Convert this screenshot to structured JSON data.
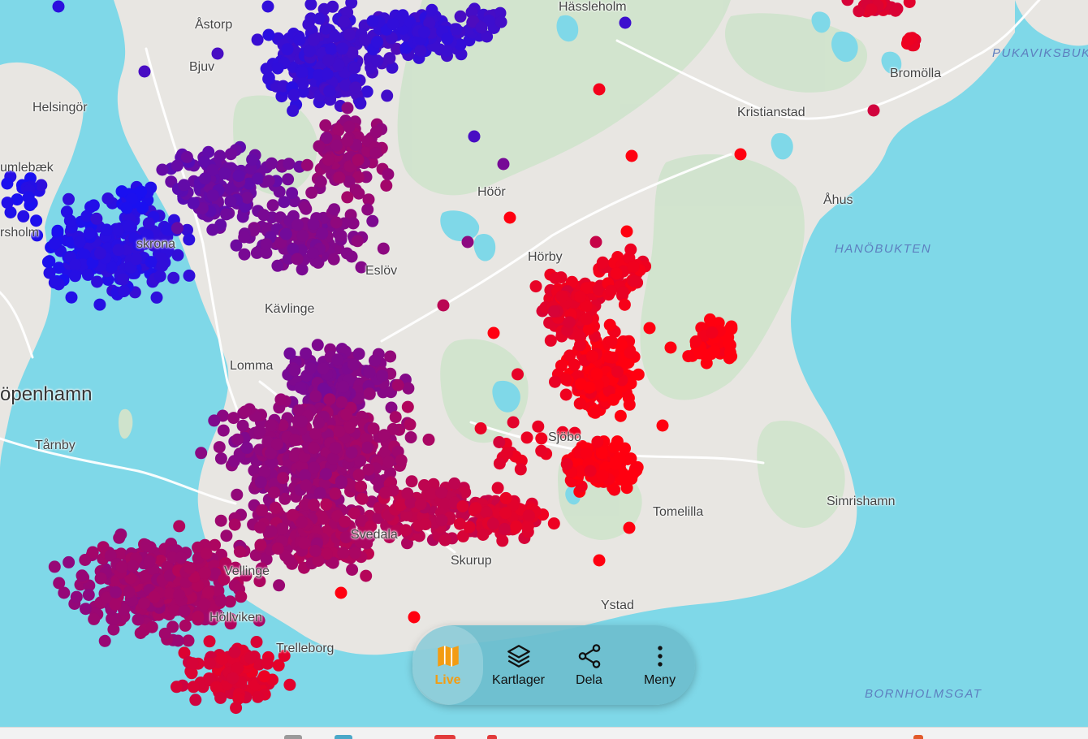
{
  "map": {
    "place_labels": [
      {
        "id": "hassleholm",
        "text": "Hässleholm"
      },
      {
        "id": "astorp",
        "text": "Åstorp"
      },
      {
        "id": "bjuv",
        "text": "Bjuv"
      },
      {
        "id": "helsingor",
        "text": "Helsingör"
      },
      {
        "id": "humlebaek",
        "text": "umlebæk"
      },
      {
        "id": "rsholm",
        "text": "rsholm"
      },
      {
        "id": "krona",
        "text": "skrona"
      },
      {
        "id": "hoor",
        "text": "Höör"
      },
      {
        "id": "hoby",
        "text": "Hörby"
      },
      {
        "id": "eslov",
        "text": "Eslöv"
      },
      {
        "id": "kavlinge",
        "text": "Kävlinge"
      },
      {
        "id": "ppenhamn",
        "text": "öpenhamn"
      },
      {
        "id": "tarnby",
        "text": "Tårnby"
      },
      {
        "id": "kristianstad",
        "text": "Kristianstad"
      },
      {
        "id": "bromolla",
        "text": "Bromölla"
      },
      {
        "id": "ahus",
        "text": "Åhus"
      },
      {
        "id": "sjobo",
        "text": "Sjöbo"
      },
      {
        "id": "tomelilla",
        "text": "Tomelilla"
      },
      {
        "id": "simrishamn",
        "text": "Simrishamn"
      },
      {
        "id": "skurup",
        "text": "Skurup"
      },
      {
        "id": "ystad",
        "text": "Ystad"
      },
      {
        "id": "vellinge",
        "text": "Vellinge"
      },
      {
        "id": "hollviken",
        "text": "Höllviken"
      },
      {
        "id": "trelleborg",
        "text": "Trelleborg"
      },
      {
        "id": "lomma",
        "text": "Lomma"
      },
      {
        "id": "svedala",
        "text": "Svedala"
      }
    ],
    "sea_labels": [
      {
        "id": "hanobukten",
        "text": "HANÖBUKTEN"
      },
      {
        "id": "bornholmsgat",
        "text": "BORNHOLMSGAT"
      },
      {
        "id": "pukaviksbukten",
        "text": "PUKAVIKSBUK"
      }
    ],
    "colors": {
      "sea": "#7fd8e8",
      "land": "#e8e6e2",
      "forest": "#cfe3cc",
      "road": "#ffffff",
      "marker_cold": "#0033ff",
      "marker_hot": "#ff0000"
    }
  },
  "nav": {
    "items": [
      {
        "id": "live",
        "label": "Live",
        "icon": "map-icon",
        "active": true
      },
      {
        "id": "kartlager",
        "label": "Kartlager",
        "icon": "layers-icon",
        "active": false
      },
      {
        "id": "dela",
        "label": "Dela",
        "icon": "share-icon",
        "active": false
      },
      {
        "id": "meny",
        "label": "Meny",
        "icon": "more-vertical-icon",
        "active": false
      }
    ]
  }
}
